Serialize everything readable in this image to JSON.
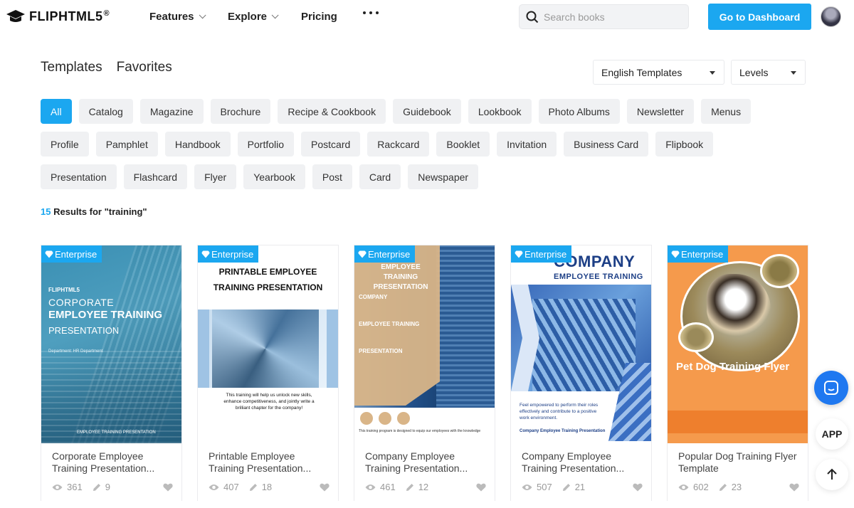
{
  "header": {
    "logo_text": "FLIPHTML5",
    "logo_reg": "®",
    "nav": [
      {
        "label": "Features",
        "has_dropdown": true
      },
      {
        "label": "Explore",
        "has_dropdown": true
      },
      {
        "label": "Pricing",
        "has_dropdown": false
      }
    ],
    "more_icon": "more-dots-icon",
    "search_placeholder": "Search books",
    "dashboard_button": "Go to Dashboard"
  },
  "section_tabs": [
    "Templates",
    "Favorites"
  ],
  "filters": {
    "language": "English Templates",
    "levels": "Levels"
  },
  "categories": [
    [
      "All",
      "Catalog",
      "Magazine",
      "Brochure",
      "Recipe & Cookbook",
      "Guidebook",
      "Lookbook",
      "Photo Albums",
      "Newsletter",
      "Menus"
    ],
    [
      "Profile",
      "Pamphlet",
      "Handbook",
      "Portfolio",
      "Postcard",
      "Rackcard",
      "Booklet",
      "Invitation",
      "Business Card",
      "Flipbook"
    ],
    [
      "Presentation",
      "Flashcard",
      "Flyer",
      "Yearbook",
      "Post",
      "Card",
      "Newspaper"
    ]
  ],
  "active_category": "All",
  "results": {
    "count": "15",
    "text": "Results for \"training\""
  },
  "cards": [
    {
      "badge": "Enterprise",
      "title_line1": "Corporate Employee",
      "title_line2": "Training Presentation...",
      "views": "361",
      "edits": "9",
      "thumb": {
        "brand": "FLIPHTML5",
        "line1": "CORPORATE",
        "line2": "EMPLOYEE TRAINING",
        "line3": "PRESENTATION",
        "line4": "Department: HR Department",
        "line5": "EMPLOYEE TRAINING PRESENTATION"
      }
    },
    {
      "badge": "Enterprise",
      "title_line1": "Printable Employee",
      "title_line2": "Training Presentation...",
      "views": "407",
      "edits": "18",
      "thumb": {
        "line1": "PRINTABLE EMPLOYEE",
        "line2": "TRAINING PRESENTATION",
        "body": "This training will help us unlock new skills, enhance competitiveness, and jointly write a brilliant chapter for the company!"
      }
    },
    {
      "badge": "Enterprise",
      "title_line1": "Company Employee",
      "title_line2": "Training Presentation...",
      "views": "461",
      "edits": "12",
      "thumb": {
        "line1": "EMPLOYEE",
        "line2": "TRAINING",
        "line3": "PRESENTATION",
        "sub1": "COMPANY",
        "sub2": "EMPLOYEE TRAINING",
        "sub3": "PRESENTATION",
        "body": "This training program is designed to equip our employees with the knowledge"
      }
    },
    {
      "badge": "Enterprise",
      "title_line1": "Company Employee",
      "title_line2": "Training Presentation...",
      "views": "507",
      "edits": "21",
      "thumb": {
        "line1": "COMPANY",
        "line2": "EMPLOYEE TRAINING",
        "body": "Feel empowered to perform their roles effectively and contribute to a positive work environment.",
        "footer": "Company Employee Training Presentation"
      }
    },
    {
      "badge": "Enterprise",
      "title_line1": "Popular Dog Training Flyer",
      "title_line2": "Template",
      "views": "602",
      "edits": "23",
      "thumb": {
        "title": "Pet Dog Training Flyer"
      }
    }
  ],
  "floating": {
    "app_label": "APP"
  },
  "colors": {
    "accent": "#1ba7f0",
    "chip_bg": "#f0f1f3"
  }
}
